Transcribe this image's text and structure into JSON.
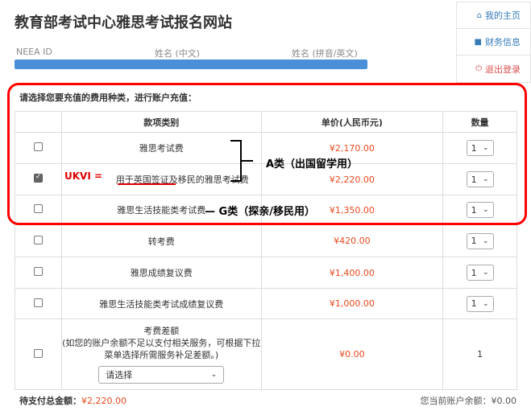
{
  "site_title": "教育部考试中心雅思考试报名网站",
  "user_info_labels": {
    "neea_id": "NEEA ID",
    "name_cn": "姓名 (中文)",
    "name_en": "姓名 (拼音/英文)"
  },
  "right_menu": [
    {
      "icon": "home-icon",
      "label": "我的主页"
    },
    {
      "icon": "briefcase-icon",
      "label": "财务信息"
    },
    {
      "icon": "power-icon",
      "label": "退出登录"
    }
  ],
  "prompt": "请选择您要充值的费用种类，进行账户充值：",
  "table": {
    "headers": {
      "category": "款项类别",
      "price": "单价(人民币元)",
      "qty": "数量"
    },
    "rows": [
      {
        "checked": false,
        "name_text": "雅思考试费",
        "price": "¥2,170.00",
        "qty": "1"
      },
      {
        "checked": true,
        "name_text": "用于英国签证及移民的雅思考试费",
        "price": "¥2,220.00",
        "qty": "1"
      },
      {
        "checked": false,
        "name_text": "雅思生活技能类考试费",
        "price": "¥1,350.00",
        "qty": "1"
      },
      {
        "checked": false,
        "name_text": "转考费",
        "price": "¥420.00",
        "qty": "1"
      },
      {
        "checked": false,
        "name_text": "雅思成绩复议费",
        "price": "¥1,400.00",
        "qty": "1"
      },
      {
        "checked": false,
        "name_text": "雅思生活技能类考试成绩复议费",
        "price": "¥1,000.00",
        "qty": "1"
      }
    ],
    "diff_row": {
      "title": "考费差额",
      "desc": "(如您的账户余额不足以支付相关服务，可根据下拉菜单选择所需服务补足差额。)",
      "select_placeholder": "请选择",
      "price": "¥0.00",
      "qty": "1"
    }
  },
  "annotations": {
    "ukvi": "UKVI =",
    "a_class": "A类（出国留学用）",
    "g_class": "— G类（探亲/移民用）"
  },
  "footer": {
    "total_label": "待支付总金额：",
    "total_value": "¥2,220.00",
    "balance_label": "您当前账户余额：",
    "balance_value": "¥0.00"
  },
  "colors": {
    "price": "#e8491d",
    "link": "#337ab7",
    "logout": "#d9534f",
    "annotation_red": "#ff0000",
    "id_bar": "#4a90d9"
  }
}
